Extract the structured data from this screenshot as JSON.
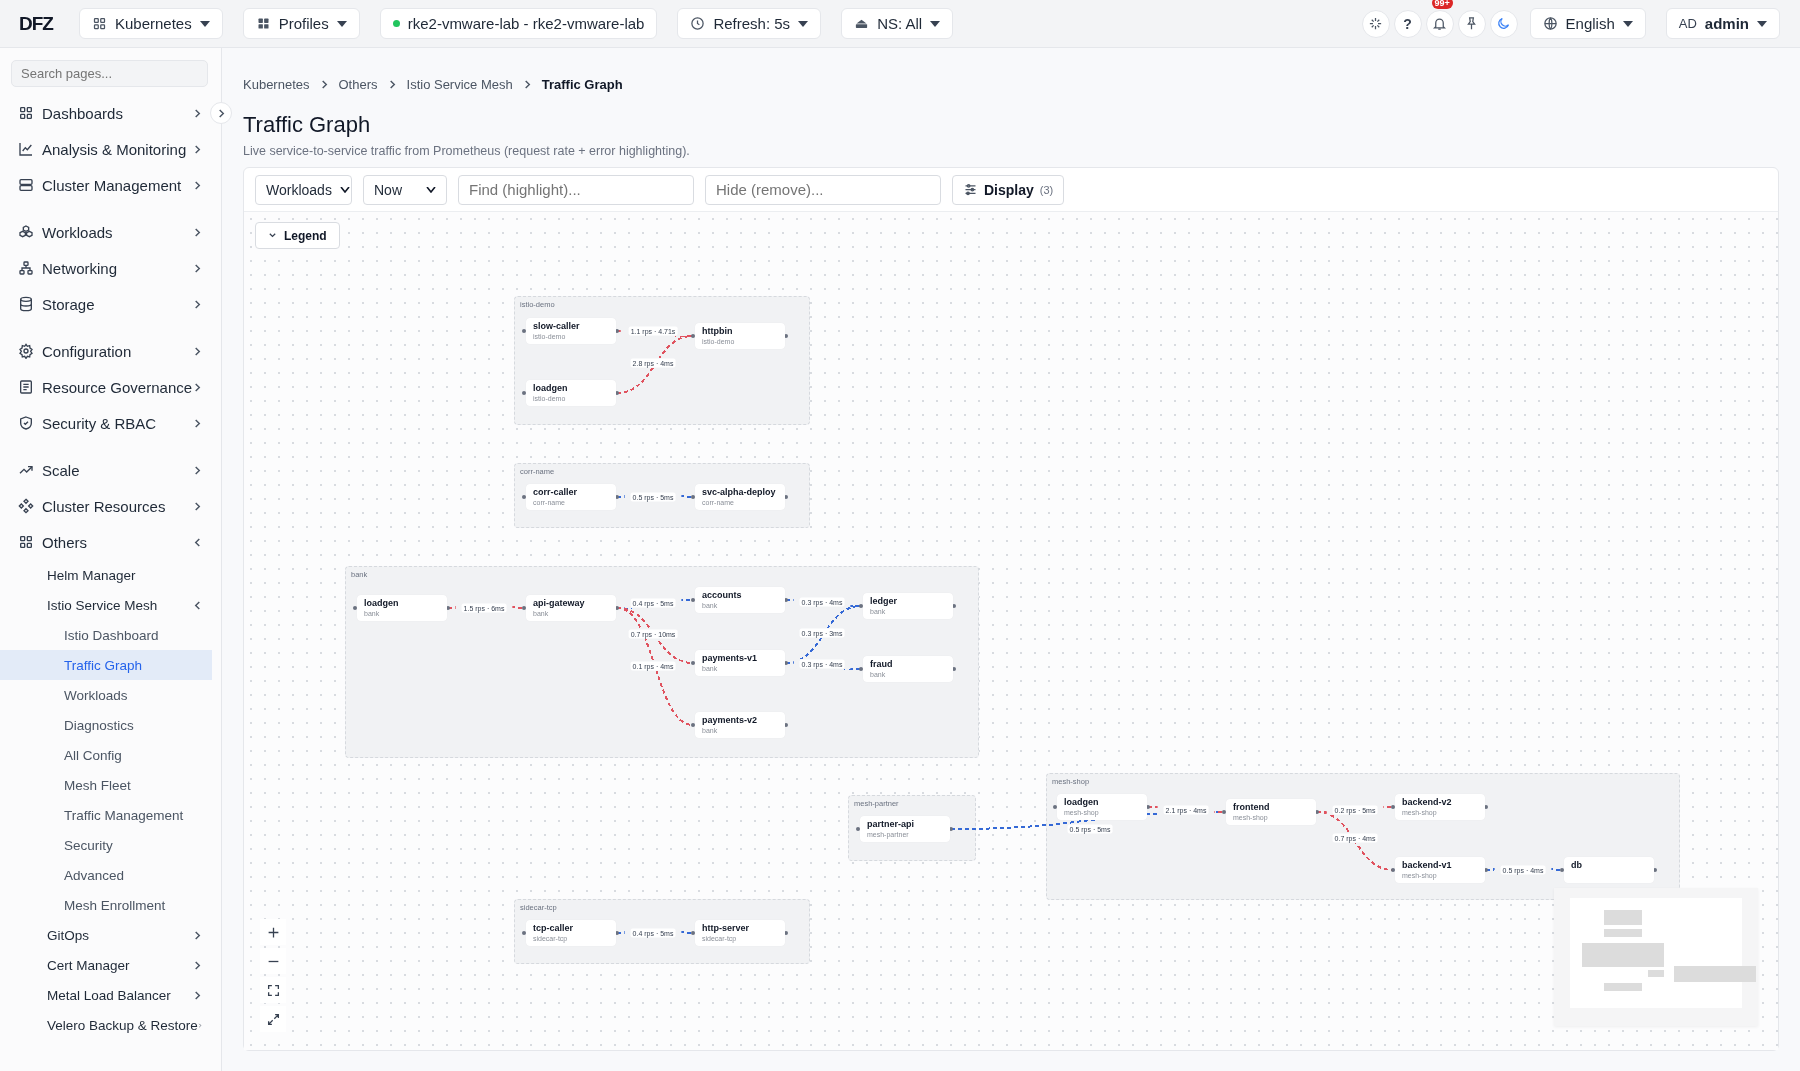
{
  "header": {
    "logo": "DFZ",
    "cluster_menu": "Kubernetes",
    "profiles_menu": "Profiles",
    "context": {
      "label": "rke2-vmware-lab - rke2-vmware-lab",
      "connected": true
    },
    "refresh": "Refresh: 5s",
    "namespace": "NS: All",
    "help": "?",
    "notification_badge": "99+",
    "language": "English",
    "user": {
      "initials": "AD",
      "name": "admin"
    }
  },
  "sidebar": {
    "search_placeholder": "Search pages...",
    "sections": [
      {
        "items": [
          {
            "label": "Dashboards",
            "selected": false,
            "expanded": false
          },
          {
            "label": "Analysis & Monitoring",
            "selected": false,
            "expanded": false
          },
          {
            "label": "Cluster Management",
            "selected": false,
            "expanded": false
          }
        ]
      },
      {
        "items": [
          {
            "label": "Workloads",
            "selected": false,
            "expanded": false
          },
          {
            "label": "Networking",
            "selected": false,
            "expanded": false
          },
          {
            "label": "Storage",
            "selected": false,
            "expanded": false
          }
        ]
      },
      {
        "items": [
          {
            "label": "Configuration",
            "selected": false,
            "expanded": false
          },
          {
            "label": "Resource Governance",
            "selected": false,
            "expanded": false
          },
          {
            "label": "Security & RBAC",
            "selected": false,
            "expanded": false
          }
        ]
      },
      {
        "items": [
          {
            "label": "Scale",
            "selected": false,
            "expanded": false
          },
          {
            "label": "Cluster Resources",
            "selected": false,
            "expanded": false
          },
          {
            "label": "Others",
            "selected": false,
            "expanded": true,
            "children": [
              {
                "label": "Helm Manager",
                "selected": false
              },
              {
                "label": "Istio Service Mesh",
                "selected": false,
                "expanded": true,
                "children": [
                  {
                    "label": "Istio Dashboard",
                    "selected": false
                  },
                  {
                    "label": "Traffic Graph",
                    "selected": true
                  },
                  {
                    "label": "Workloads",
                    "selected": false
                  },
                  {
                    "label": "Diagnostics",
                    "selected": false
                  },
                  {
                    "label": "All Config",
                    "selected": false
                  },
                  {
                    "label": "Mesh Fleet",
                    "selected": false
                  },
                  {
                    "label": "Traffic Management",
                    "selected": false
                  },
                  {
                    "label": "Security",
                    "selected": false
                  },
                  {
                    "label": "Advanced",
                    "selected": false
                  },
                  {
                    "label": "Mesh Enrollment",
                    "selected": false
                  }
                ]
              },
              {
                "label": "GitOps",
                "selected": false,
                "expanded": false
              },
              {
                "label": "Cert Manager",
                "selected": false,
                "expanded": false
              },
              {
                "label": "Metal Load Balancer",
                "selected": false,
                "expanded": false
              },
              {
                "label": "Velero Backup & Restore",
                "selected": false,
                "expanded": false
              }
            ]
          }
        ]
      }
    ]
  },
  "breadcrumb": [
    "Kubernetes",
    "Others",
    "Istio Service Mesh",
    "Traffic Graph"
  ],
  "page": {
    "title": "Traffic Graph",
    "subtitle": "Live service-to-service traffic from Prometheus (request rate + error highlighting)."
  },
  "toolbar": {
    "view": "Workloads",
    "time_range": "Now",
    "find_placeholder": "Find (highlight)...",
    "hide_placeholder": "Hide (remove)...",
    "display_button": "Display",
    "display_count": "(3)"
  },
  "graph": {
    "legend_button": "Legend",
    "groups": [
      {
        "name": "istio-demo",
        "nodes": [
          {
            "name": "slow-caller",
            "namespace": "istio-demo"
          },
          {
            "name": "httpbin",
            "namespace": "istio-demo"
          },
          {
            "name": "loadgen",
            "namespace": "istio-demo"
          }
        ]
      },
      {
        "name": "corr-name",
        "nodes": [
          {
            "name": "corr-caller",
            "namespace": "corr-name"
          },
          {
            "name": "svc-alpha-deploy",
            "namespace": "corr-name"
          }
        ]
      },
      {
        "name": "bank",
        "nodes": [
          {
            "name": "loadgen",
            "namespace": "bank"
          },
          {
            "name": "api-gateway",
            "namespace": "bank"
          },
          {
            "name": "accounts",
            "namespace": "bank"
          },
          {
            "name": "ledger",
            "namespace": "bank"
          },
          {
            "name": "payments-v1",
            "namespace": "bank"
          },
          {
            "name": "fraud",
            "namespace": "bank"
          },
          {
            "name": "payments-v2",
            "namespace": "bank"
          }
        ]
      },
      {
        "name": "mesh-partner",
        "nodes": [
          {
            "name": "partner-api",
            "namespace": "mesh-partner"
          }
        ]
      },
      {
        "name": "mesh-shop",
        "nodes": [
          {
            "name": "loadgen",
            "namespace": "mesh-shop"
          },
          {
            "name": "frontend",
            "namespace": "mesh-shop"
          },
          {
            "name": "backend-v2",
            "namespace": "mesh-shop"
          },
          {
            "name": "backend-v1",
            "namespace": "mesh-shop"
          },
          {
            "name": "db"
          }
        ]
      },
      {
        "name": "sidecar-tcp",
        "nodes": [
          {
            "name": "tcp-caller",
            "namespace": "sidecar-tcp"
          },
          {
            "name": "http-server",
            "namespace": "sidecar-tcp"
          }
        ]
      }
    ],
    "edges": [
      {
        "label": "1.1 rps · 4.71s",
        "color": "#e0535f"
      },
      {
        "label": "2.8 rps · 4ms",
        "color": "#e0535f"
      },
      {
        "label": "0.5 rps · 5ms",
        "color": "#3569d6"
      },
      {
        "label": "1.5 rps · 6ms",
        "color": "#e0535f"
      },
      {
        "label": "0.4 rps · 5ms",
        "color": "#3569d6"
      },
      {
        "label": "0.7 rps · 10ms",
        "color": "#e0535f"
      },
      {
        "label": "0.1 rps · 4ms",
        "color": "#e0535f"
      },
      {
        "label": "0.3 rps · 4ms",
        "color": "#3569d6"
      },
      {
        "label": "0.3 rps · 3ms",
        "color": "#3569d6"
      },
      {
        "label": "0.3 rps · 4ms",
        "color": "#3569d6"
      },
      {
        "label": "0.5 rps · 5ms",
        "color": "#3569d6"
      },
      {
        "label": "2.1 rps · 4ms",
        "color": "#e0535f"
      },
      {
        "label": "0.2 rps · 5ms",
        "color": "#e0535f"
      },
      {
        "label": "0.7 rps · 4ms",
        "color": "#e0535f"
      },
      {
        "label": "0.5 rps · 4ms",
        "color": "#3569d6"
      },
      {
        "label": "0.4 rps · 5ms",
        "color": "#3569d6"
      }
    ]
  }
}
